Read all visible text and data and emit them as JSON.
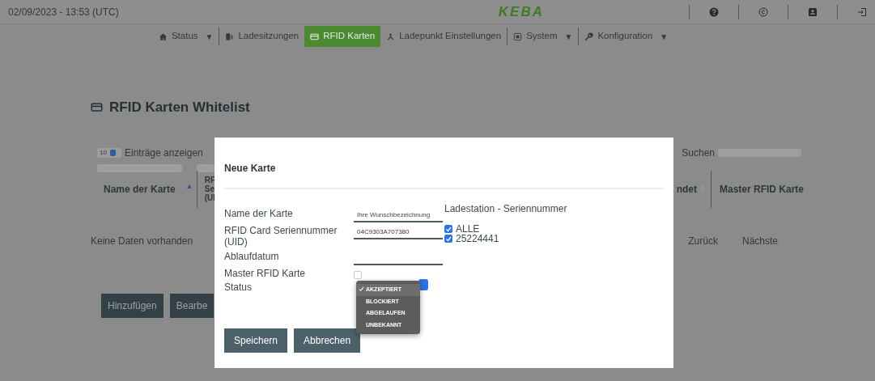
{
  "top_bar": {
    "datetime": "02/09/2023 - 13:53 (UTC)",
    "logo": "KEBA"
  },
  "nav": [
    {
      "label": "Status",
      "caret": "▼",
      "selected": false
    },
    {
      "label": "Ladesitzungen",
      "selected": false
    },
    {
      "label": "RFID Karten",
      "selected": true
    },
    {
      "label": "Ladepunkt Einstellungen",
      "selected": false
    },
    {
      "label": "System",
      "caret": "▼",
      "selected": false
    },
    {
      "label": "Konfiguration",
      "caret": "▼",
      "selected": false
    }
  ],
  "page": {
    "title": "RFID Karten Whitelist",
    "length_select": "10",
    "length_label": "Einträge anzeigen",
    "search_label": "Suchen",
    "columns_left": [
      "Name der Karte",
      "RF Se (UI"
    ],
    "columns_right": [
      "ndet",
      "Master RFID Karte"
    ],
    "empty_text": "Keine Daten vorhanden",
    "pagination": [
      "Zurück",
      "Nächste"
    ],
    "buttons": [
      "Hinzufügen",
      "Bearbe"
    ]
  },
  "dialog": {
    "title": "Neue Karte",
    "fields": [
      {
        "label": "Name der Karte",
        "kind": "text",
        "placeholder": "Ihre Wunschbezeichnung"
      },
      {
        "label": "RFID Card Seriennummer (UID)",
        "kind": "text",
        "value": "04C9303A707380"
      },
      {
        "label": "Ablaufdatum",
        "kind": "text"
      },
      {
        "label": "Master RFID Karte",
        "kind": "checkbox",
        "checked": false
      },
      {
        "label": "Status",
        "kind": "select"
      }
    ],
    "stations_label": "Ladestation - Seriennummer",
    "stations": [
      {
        "label": "ALLE",
        "checked": true
      },
      {
        "label": "25224441",
        "checked": true
      }
    ],
    "status_options": [
      {
        "label": "AKZEPTIERT",
        "selected": true
      },
      {
        "label": "BLOCKIERT",
        "selected": false
      },
      {
        "label": "ABGELAUFEN",
        "selected": false
      },
      {
        "label": "UNBEKANNT",
        "selected": false
      }
    ],
    "buttons": [
      "Speichern",
      "Abbrechen"
    ]
  }
}
